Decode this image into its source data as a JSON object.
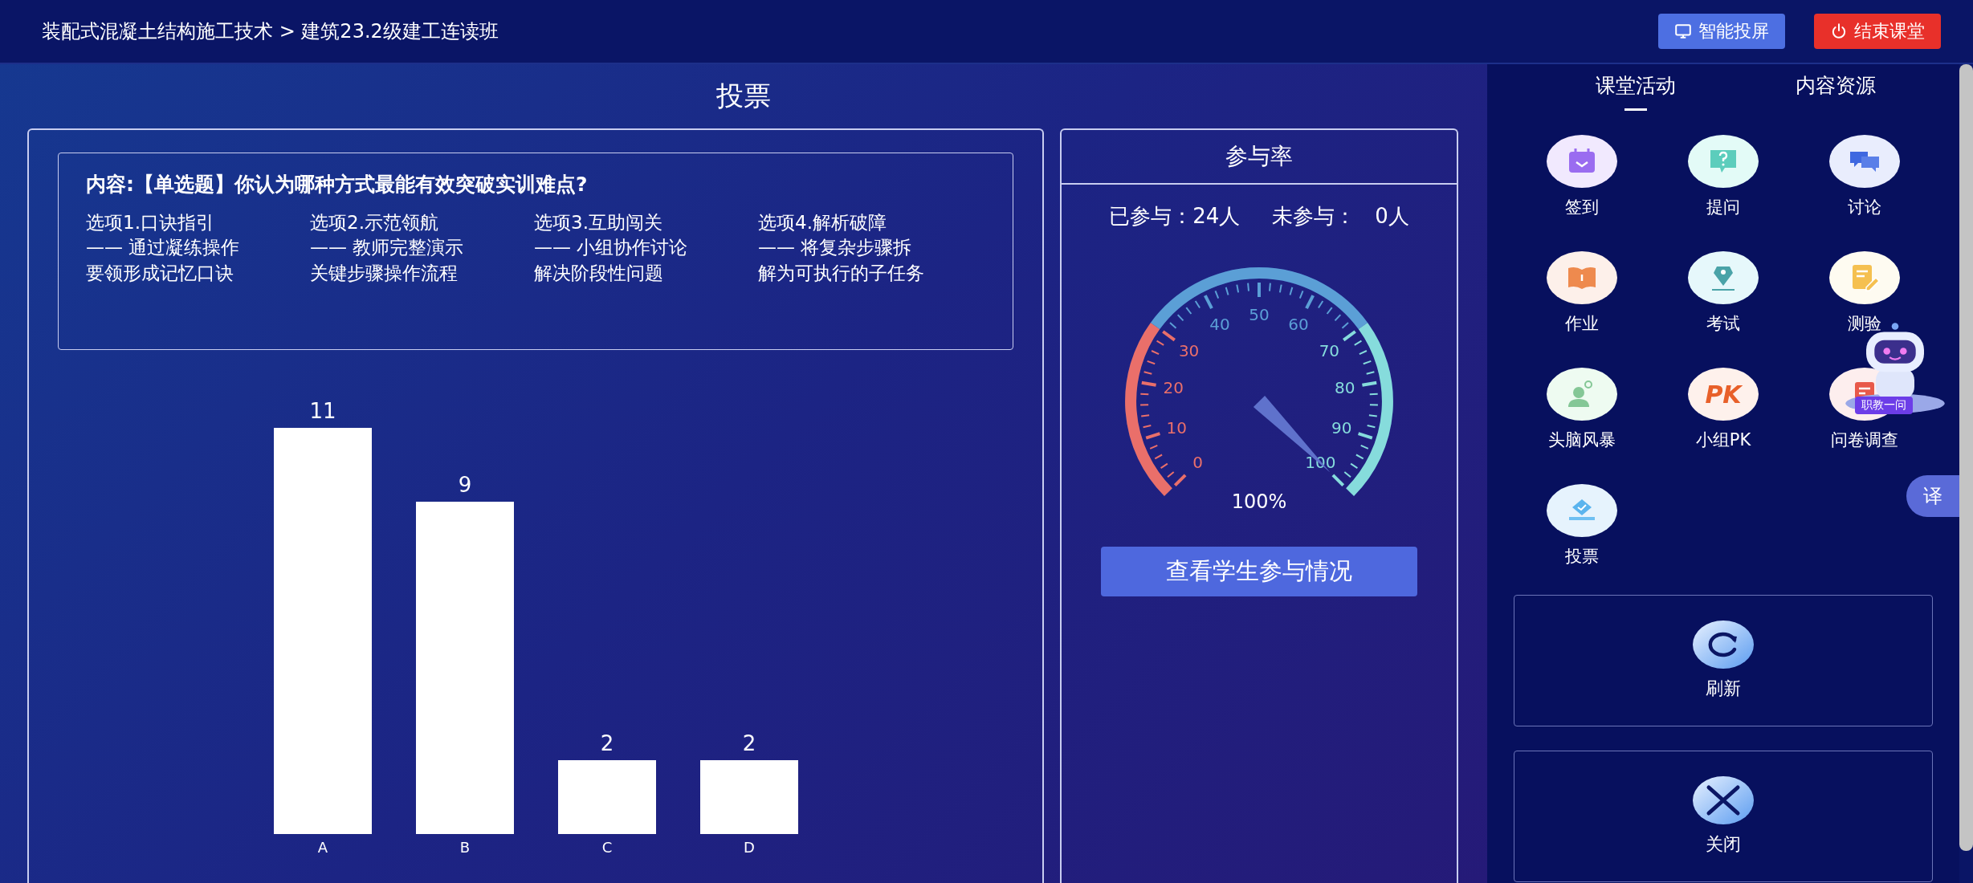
{
  "header": {
    "breadcrumb": "装配式混凝土结构施工技术 > 建筑23.2级建工连读班",
    "buttons": [
      {
        "label": "智能投屏",
        "kind": "cast"
      },
      {
        "label": "结束课堂",
        "kind": "end"
      }
    ]
  },
  "page_title": "投票",
  "question": {
    "text": "内容:【单选题】你认为哪种方式最能有效突破实训难点?",
    "options": [
      {
        "title": "选项1.口诀指引",
        "description": "—— 通过凝练操作要领形成记忆口诀"
      },
      {
        "title": "选项2.示范领航",
        "description": "—— 教师完整演示关键步骤操作流程"
      },
      {
        "title": "选项3.互助闯关",
        "description": "—— 小组协作讨论解决阶段性问题"
      },
      {
        "title": "选项4.解析破障",
        "description": "—— 将复杂步骤拆解为可执行的子任务"
      }
    ]
  },
  "results": {
    "chart_data": {
      "type": "bar",
      "categories": [
        "A",
        "B",
        "C",
        "D"
      ],
      "values": [
        11,
        9,
        2,
        2
      ],
      "data_labels": true
    }
  },
  "participation": {
    "title": "参与率",
    "stats": [
      {
        "label": "已参与：",
        "value": "24人"
      },
      {
        "label": "未参与：",
        "value": "0人"
      }
    ],
    "gauge": {
      "level": 1,
      "reading": "100%",
      "tick_labels": [
        "0",
        "10",
        "20",
        "30",
        "40",
        "50",
        "60",
        "70",
        "80",
        "90",
        "100"
      ]
    },
    "button": "查看学生参与情况"
  },
  "sidebar": {
    "tabs": [
      {
        "label": "课堂活动",
        "selected": true
      },
      {
        "label": "内容资源",
        "selected": false
      }
    ],
    "activities": [
      {
        "label": "签到"
      },
      {
        "label": "提问"
      },
      {
        "label": "讨论"
      },
      {
        "label": "作业"
      },
      {
        "label": "考试"
      },
      {
        "label": "测验"
      },
      {
        "label": "头脑风暴"
      },
      {
        "label": "小组PK",
        "icon_text": "PK"
      },
      {
        "label": "问卷调查"
      },
      {
        "label": "投票"
      }
    ],
    "actions": [
      {
        "label": "刷新",
        "kind": "refresh"
      },
      {
        "label": "关闭",
        "kind": "close"
      }
    ]
  },
  "assistant": {
    "badge": "职教一问"
  },
  "translate_button": "译"
}
